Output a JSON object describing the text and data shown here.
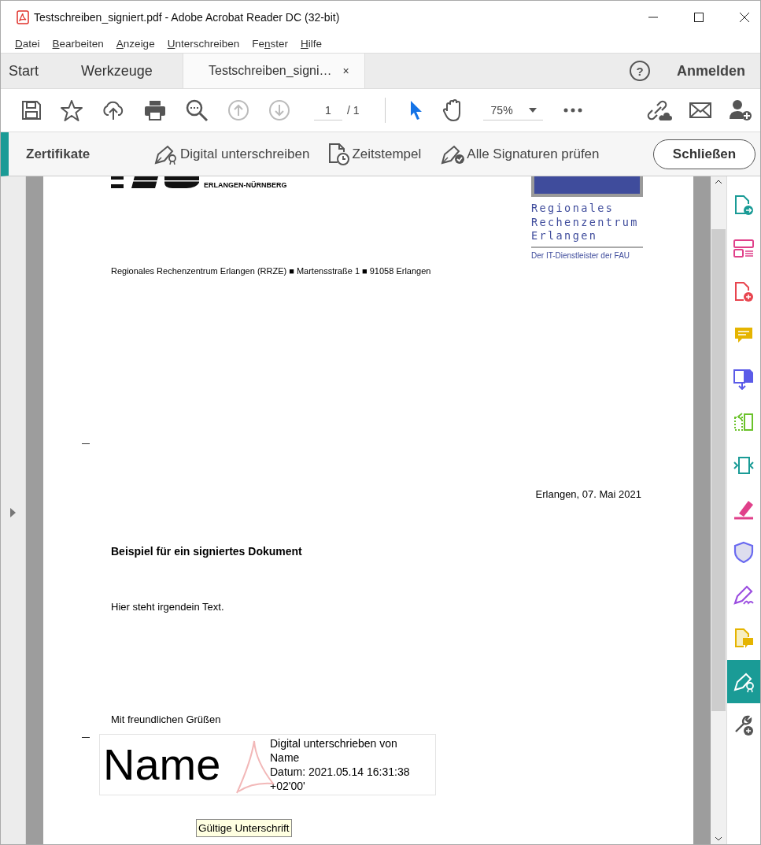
{
  "window": {
    "title": "Testschreiben_signiert.pdf - Adobe Acrobat Reader DC (32-bit)"
  },
  "menu": [
    {
      "key": "D",
      "post": "atei"
    },
    {
      "key": "B",
      "post": "earbeiten"
    },
    {
      "key": "A",
      "post": "nzeige"
    },
    {
      "key": "U",
      "post": "nterschreiben"
    },
    {
      "pre": "Fe",
      "key": "n",
      "post": "ster"
    },
    {
      "key": "H",
      "post": "ilfe"
    }
  ],
  "tabs": [
    {
      "label": "Start",
      "selected": false
    },
    {
      "label": "Werkzeuge",
      "selected": false
    },
    {
      "label": "Testschreiben_signi…",
      "selected": true,
      "close": "×"
    }
  ],
  "help": "?",
  "sign_in": "Anmelden",
  "toolbar": {
    "page": "1",
    "page_total": "/ 1",
    "zoom": "75%"
  },
  "cert_bar": {
    "title": "Zertifikate",
    "actions": [
      {
        "kind": "sign",
        "label": "Digital unterschreiben"
      },
      {
        "kind": "timestamp",
        "label": "Zeitstempel"
      },
      {
        "kind": "validate",
        "label": "Alle Signaturen prüfen"
      }
    ],
    "close": "Schließen"
  },
  "document": {
    "logo_subtitle": "ERLANGEN-NÜRNBERG",
    "rrze_lines": [
      "Regionales",
      "Rechenzentrum",
      "Erlangen"
    ],
    "rrze_tagline": "Der IT-Dienstleister der FAU",
    "sender": "Regionales Rechenzentrum Erlangen (RRZE) ■ Martensstraße 1 ■ 91058 Erlangen",
    "date": "Erlangen, 07. Mai 2021",
    "heading": "Beispiel für ein signiertes Dokument",
    "body": "Hier steht irgendein Text.",
    "closing": "Mit freundlichen Grüßen",
    "signature": {
      "name": "Name",
      "details": [
        "Digital unterschrieben von",
        "Name",
        "Datum: 2021.05.14 16:31:38",
        "+02'00'"
      ]
    },
    "tooltip": "Gültige Unterschrift"
  },
  "tools": [
    {
      "kind": "export",
      "selected": false
    },
    {
      "kind": "layout",
      "selected": false
    },
    {
      "kind": "create",
      "selected": false
    },
    {
      "kind": "comment",
      "selected": false
    },
    {
      "kind": "combine",
      "selected": false
    },
    {
      "kind": "organize",
      "selected": false
    },
    {
      "kind": "compress",
      "selected": false
    },
    {
      "kind": "highlight",
      "selected": false
    },
    {
      "kind": "protect",
      "selected": false
    },
    {
      "kind": "sign",
      "selected": false
    },
    {
      "kind": "send",
      "selected": false
    },
    {
      "kind": "certificate",
      "selected": true
    },
    {
      "kind": "more",
      "selected": false
    }
  ]
}
